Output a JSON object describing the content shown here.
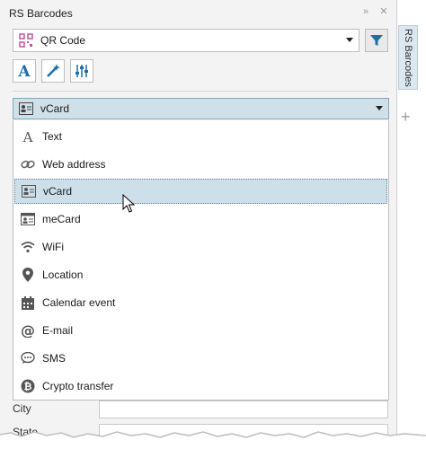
{
  "window": {
    "title": "RS Barcodes"
  },
  "toolbar": {
    "barcode_type": "QR Code",
    "filter_icon": "filter-icon",
    "tools": [
      "text-style-icon",
      "magic-wand-icon",
      "sliders-icon"
    ]
  },
  "content_type": {
    "selected": "vCard",
    "options": [
      {
        "label": "Text",
        "icon": "text-icon"
      },
      {
        "label": "Web address",
        "icon": "link-icon"
      },
      {
        "label": "vCard",
        "icon": "contact-card-icon"
      },
      {
        "label": "meCard",
        "icon": "mecard-icon"
      },
      {
        "label": "WiFi",
        "icon": "wifi-icon"
      },
      {
        "label": "Location",
        "icon": "location-pin-icon"
      },
      {
        "label": "Calendar event",
        "icon": "calendar-icon"
      },
      {
        "label": "E-mail",
        "icon": "at-icon"
      },
      {
        "label": "SMS",
        "icon": "chat-bubble-icon"
      },
      {
        "label": "Crypto transfer",
        "icon": "bitcoin-icon"
      }
    ]
  },
  "form": {
    "city_label": "City",
    "state_label": "State"
  },
  "side_tab": {
    "label": "RS Barcodes"
  },
  "colors": {
    "accent": "#1d6fa5",
    "selection": "#cde0ea",
    "qr_icon": "#c2569b"
  }
}
